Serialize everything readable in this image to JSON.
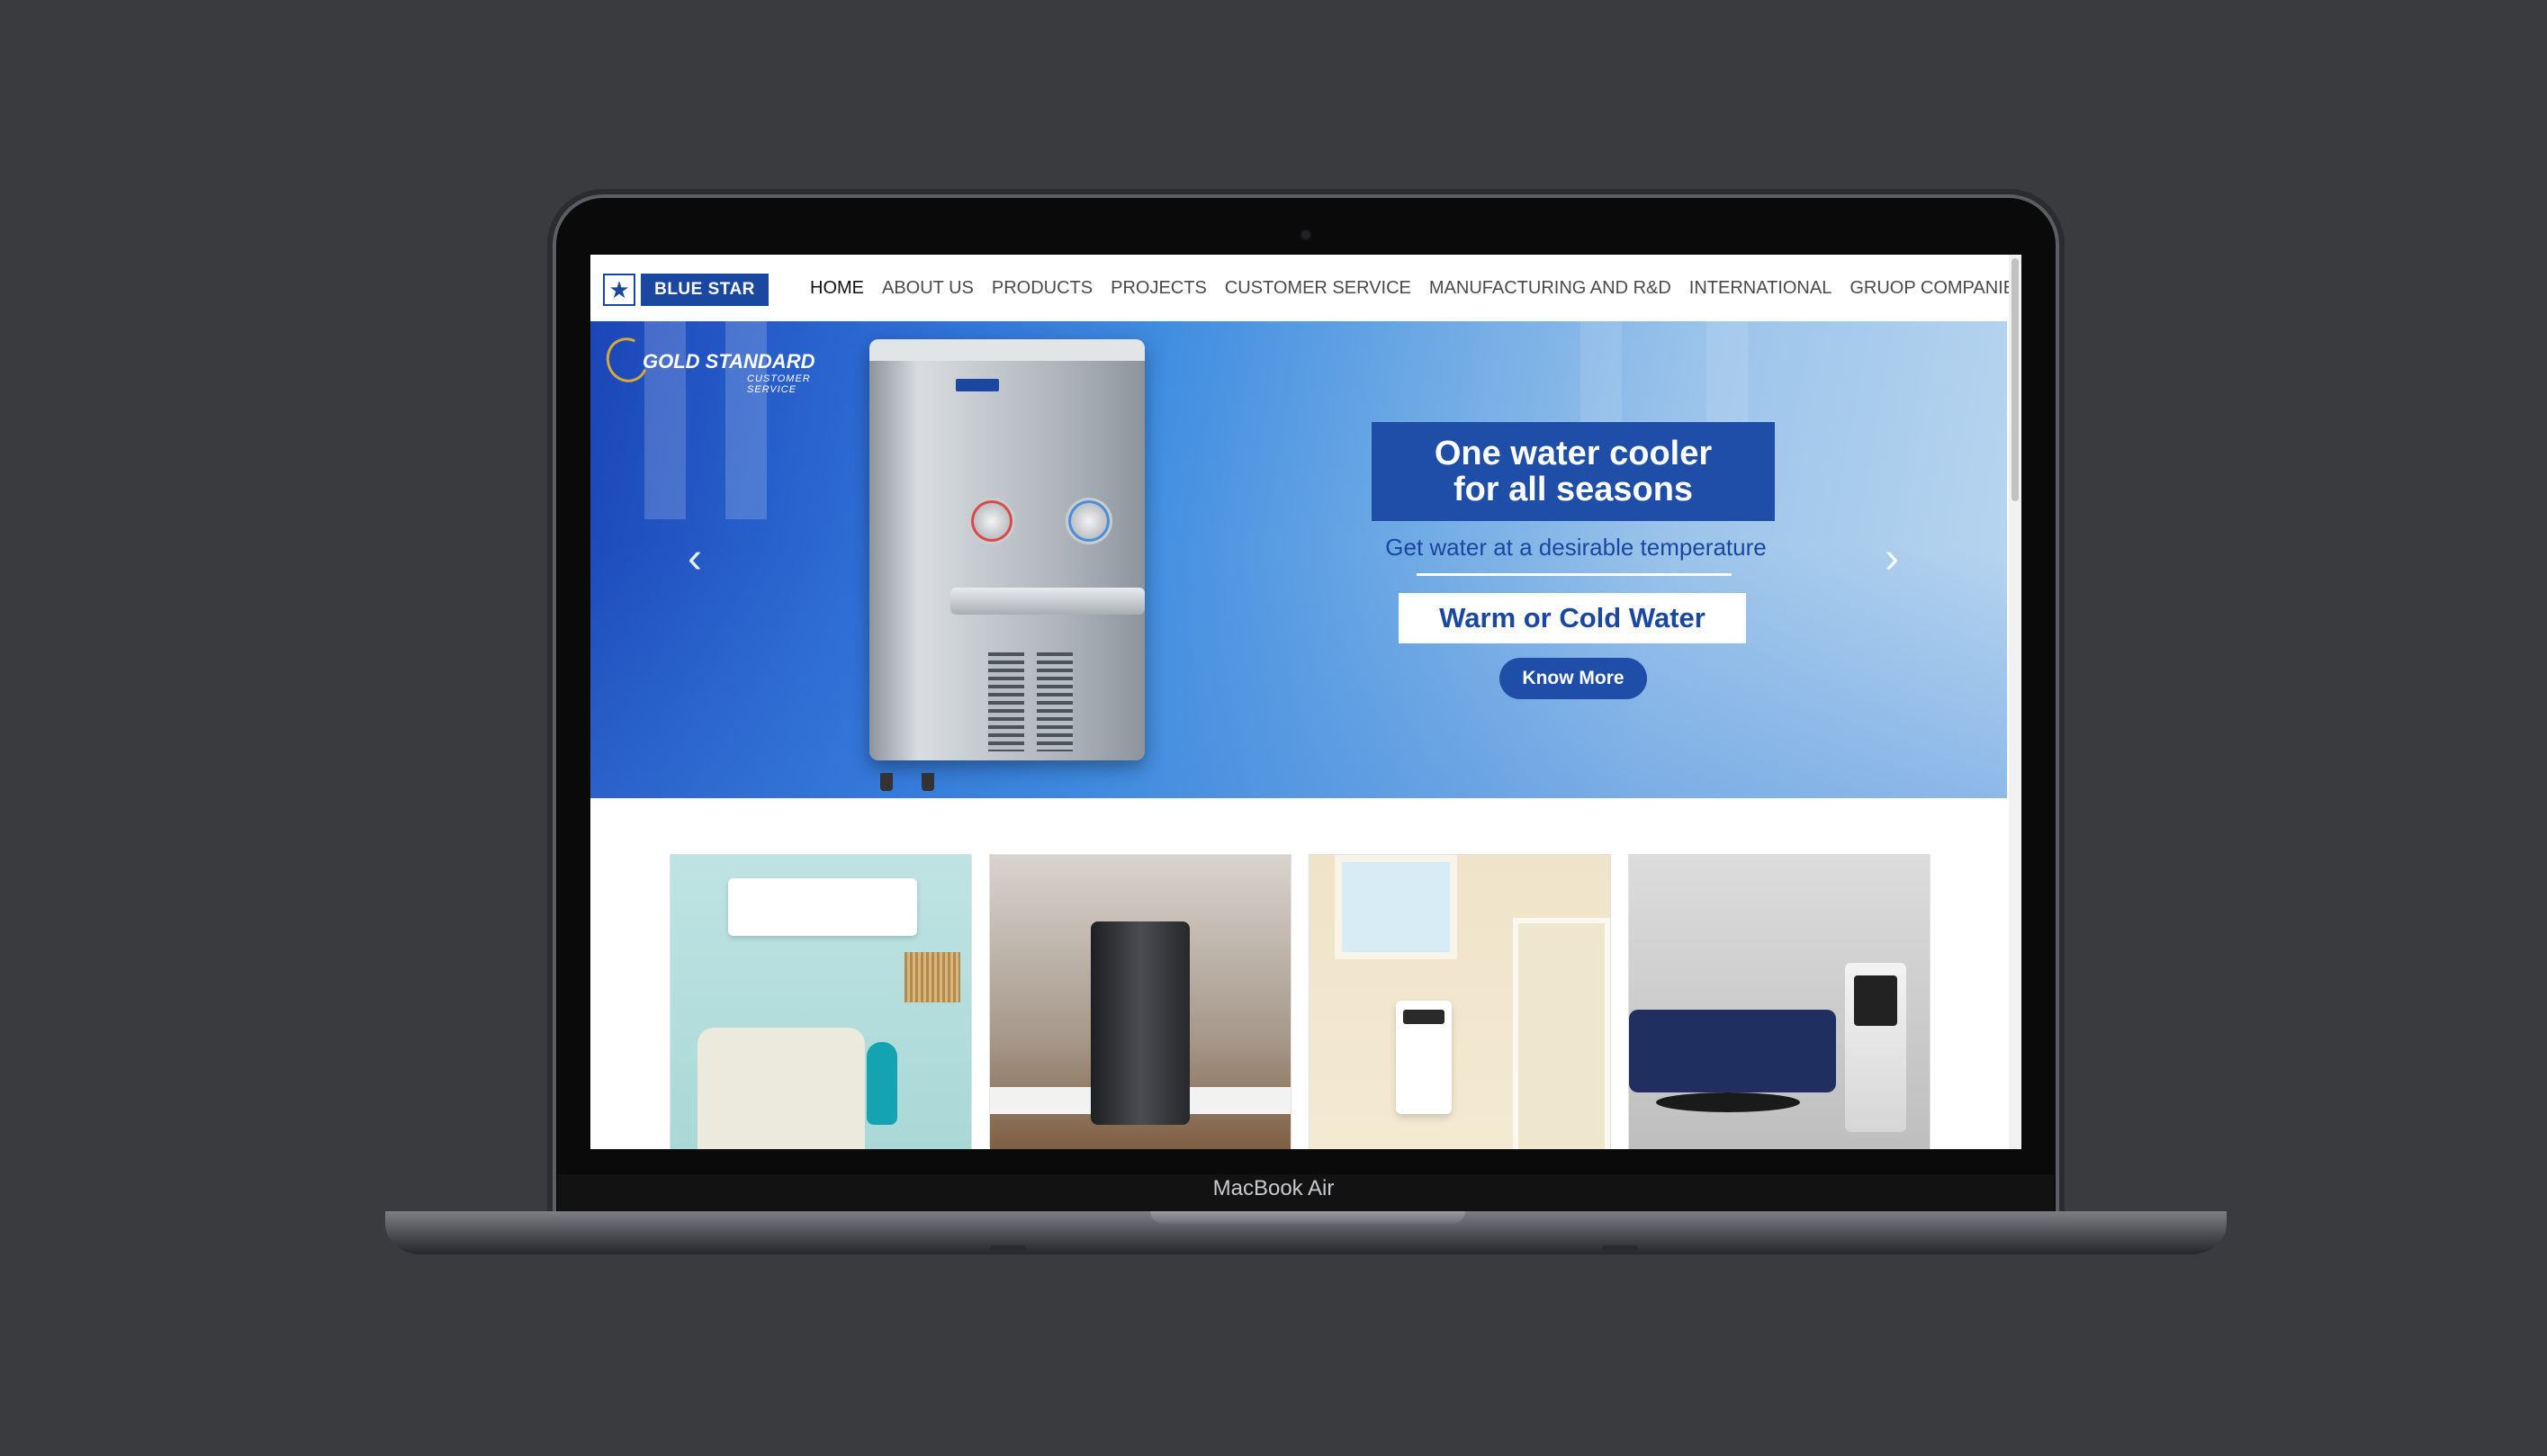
{
  "device": {
    "label": "MacBook Air"
  },
  "nav": {
    "logo_text": "BLUE STAR",
    "logo_icon": "star-icon",
    "items": [
      {
        "label": "HOME",
        "active": true
      },
      {
        "label": "ABOUT US"
      },
      {
        "label": "PRODUCTS"
      },
      {
        "label": "PROJECTS"
      },
      {
        "label": "CUSTOMER SERVICE"
      },
      {
        "label": "MANUFACTURING AND R&D"
      },
      {
        "label": "INTERNATIONAL"
      },
      {
        "label": "GRUOP COMPANIES"
      }
    ]
  },
  "hero": {
    "badge_title": "GOLD STANDARD",
    "badge_sub": "CUSTOMER SERVICE",
    "headline_line1": "One water cooler",
    "headline_line2": "for all seasons",
    "tagline": "Get water at a desirable temperature",
    "subheadline": "Warm or Cold Water",
    "cta_label": "Know More",
    "prev_arrow": "‹",
    "next_arrow": "›"
  },
  "cards": [
    {
      "icon": "air-conditioner-image"
    },
    {
      "icon": "water-purifier-image"
    },
    {
      "icon": "air-purifier-image"
    },
    {
      "icon": "air-cooler-image"
    }
  ],
  "colors": {
    "brand_blue": "#1a47a0",
    "cta_blue": "#1f4ea8",
    "background": "#3a3b3f"
  }
}
